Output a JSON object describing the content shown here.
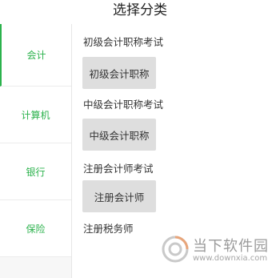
{
  "header": {
    "title": "选择分类"
  },
  "sidebar": {
    "items": [
      {
        "label": "会计",
        "active": true
      },
      {
        "label": "计算机",
        "active": false
      },
      {
        "label": "银行",
        "active": false
      },
      {
        "label": "保险",
        "active": false
      }
    ]
  },
  "content": {
    "sections": [
      {
        "title": "初级会计职称考试",
        "chips": [
          "初级会计职称"
        ]
      },
      {
        "title": "中级会计职称考试",
        "chips": [
          "中级会计职称"
        ]
      },
      {
        "title": "注册会计师考试",
        "chips": [
          "注册会计师"
        ]
      },
      {
        "title": "注册税务师",
        "chips": []
      }
    ]
  },
  "watermark": {
    "text": "当下软件园",
    "url": "www.downxia.com"
  },
  "colors": {
    "accent": "#2bb24c",
    "chip_bg": "#dedede",
    "sidebar_bg": "#f7f7f7"
  }
}
